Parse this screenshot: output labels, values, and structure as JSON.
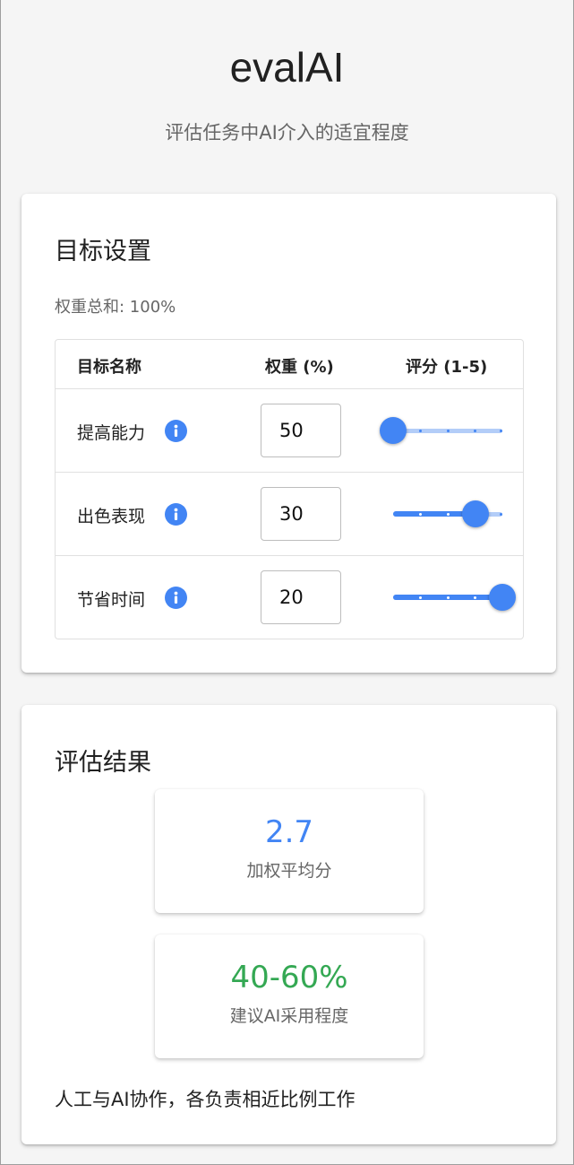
{
  "header": {
    "title": "evalAI",
    "subtitle": "评估任务中AI介入的适宜程度"
  },
  "goals": {
    "title": "目标设置",
    "weight_sum": "权重总和: 100%",
    "columns": [
      "目标名称",
      "权重 (%)",
      "评分 (1-5)"
    ],
    "rows": [
      {
        "name": "提高能力",
        "weight": "50",
        "score": 1
      },
      {
        "name": "出色表现",
        "weight": "30",
        "score": 4
      },
      {
        "name": "节省时间",
        "weight": "20",
        "score": 5
      }
    ],
    "score_min": 1,
    "score_max": 5
  },
  "results": {
    "title": "评估结果",
    "weighted_score": "2.7",
    "weighted_score_label": "加权平均分",
    "adoption": "40-60%",
    "adoption_label": "建议AI采用程度",
    "recommendation": "人工与AI协作，各负责相近比例工作"
  },
  "colors": {
    "accent": "#4285f4",
    "success": "#34a853"
  },
  "icons": {
    "info": "info-icon"
  }
}
